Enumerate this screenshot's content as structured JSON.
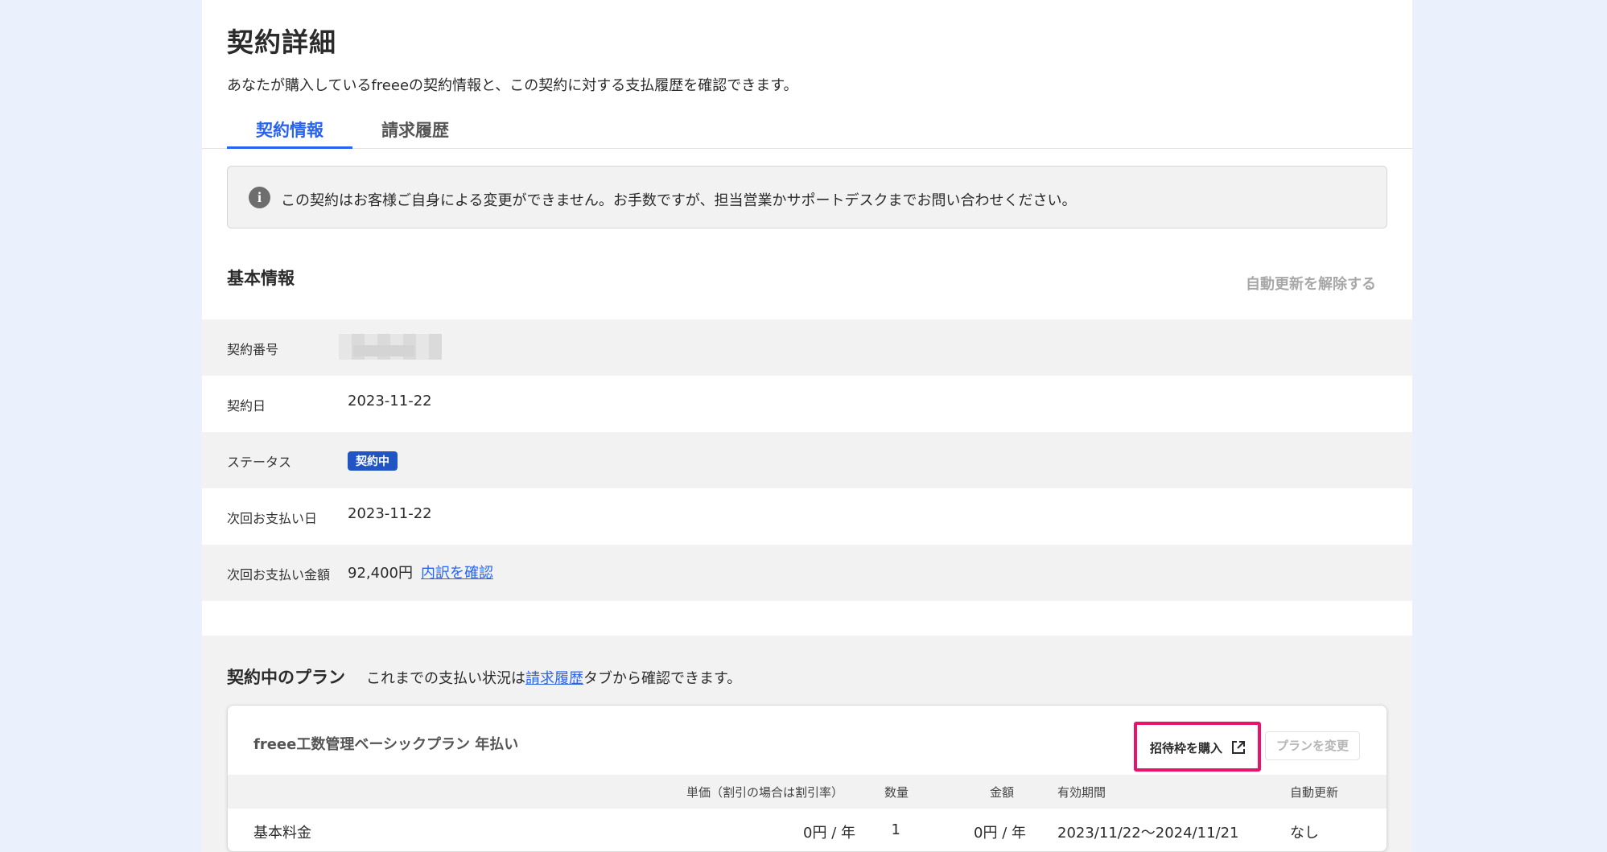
{
  "page": {
    "title": "契約詳細",
    "subtitle": "あなたが購入しているfreeeの契約情報と、この契約に対する支払履歴を確認できます。"
  },
  "tabs": [
    {
      "label": "契約情報",
      "active": true
    },
    {
      "label": "請求履歴",
      "active": false
    }
  ],
  "notice": {
    "icon": "info-icon",
    "text": "この契約はお客様ご自身による変更ができません。お手数ですが、担当営業かサポートデスクまでお問い合わせください。"
  },
  "basic_info": {
    "title": "基本情報",
    "unsubscribe_label": "自動更新を解除する",
    "rows": {
      "contract_number": {
        "label": "契約番号"
      },
      "contract_date": {
        "label": "契約日",
        "value": "2023-11-22"
      },
      "status": {
        "label": "ステータス",
        "badge": "契約中"
      },
      "next_payment_date": {
        "label": "次回お支払い日",
        "value": "2023-11-22"
      },
      "next_payment_amount": {
        "label": "次回お支払い金額",
        "value": "92,400円",
        "link": "内訳を確認"
      }
    }
  },
  "plan": {
    "heading": "契約中のプラン",
    "note_before": "これまでの支払い状況は",
    "note_link": "請求履歴",
    "note_after": "タブから確認できます。",
    "name": "freee工数管理ベーシックプラン 年払い",
    "buy_label": "招待枠を購入",
    "buy_icon": "external-link-icon",
    "change_label": "プランを変更",
    "columns": {
      "unit_price": "単価（割引の場合は割引率）",
      "quantity": "数量",
      "amount": "金額",
      "period": "有効期間",
      "auto_renew": "自動更新"
    },
    "rows": [
      {
        "item": "基本料金",
        "unit_price": "0円 / 年",
        "quantity": "1",
        "amount": "0円 / 年",
        "period": "2023/11/22〜2024/11/21",
        "auto_renew": "なし"
      }
    ]
  },
  "colors": {
    "accent": "#2864f0",
    "badge": "#2155c4",
    "highlight": "#e8136b",
    "background": "#ebf1fc"
  }
}
